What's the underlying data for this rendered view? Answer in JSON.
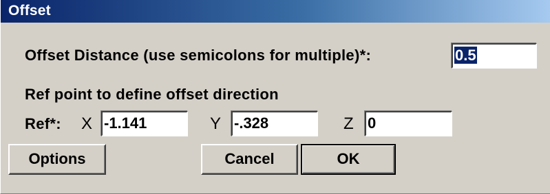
{
  "window": {
    "title": "Offset"
  },
  "offset_distance": {
    "label": "Offset Distance (use semicolons for multiple)*:",
    "value": "0.5"
  },
  "ref_point": {
    "heading": "Ref point to define offset direction",
    "label": "Ref*:",
    "x_label": "X",
    "x_value": "-1.141",
    "y_label": "Y",
    "y_value": "-.328",
    "z_label": "Z",
    "z_value": "0"
  },
  "buttons": {
    "options": "Options",
    "cancel": "Cancel",
    "ok": "OK"
  },
  "colors": {
    "title_gradient_start": "#0a246a",
    "title_gradient_end": "#a6caf0",
    "dialog_background": "#d4d0c8",
    "selection": "#0a246a"
  }
}
